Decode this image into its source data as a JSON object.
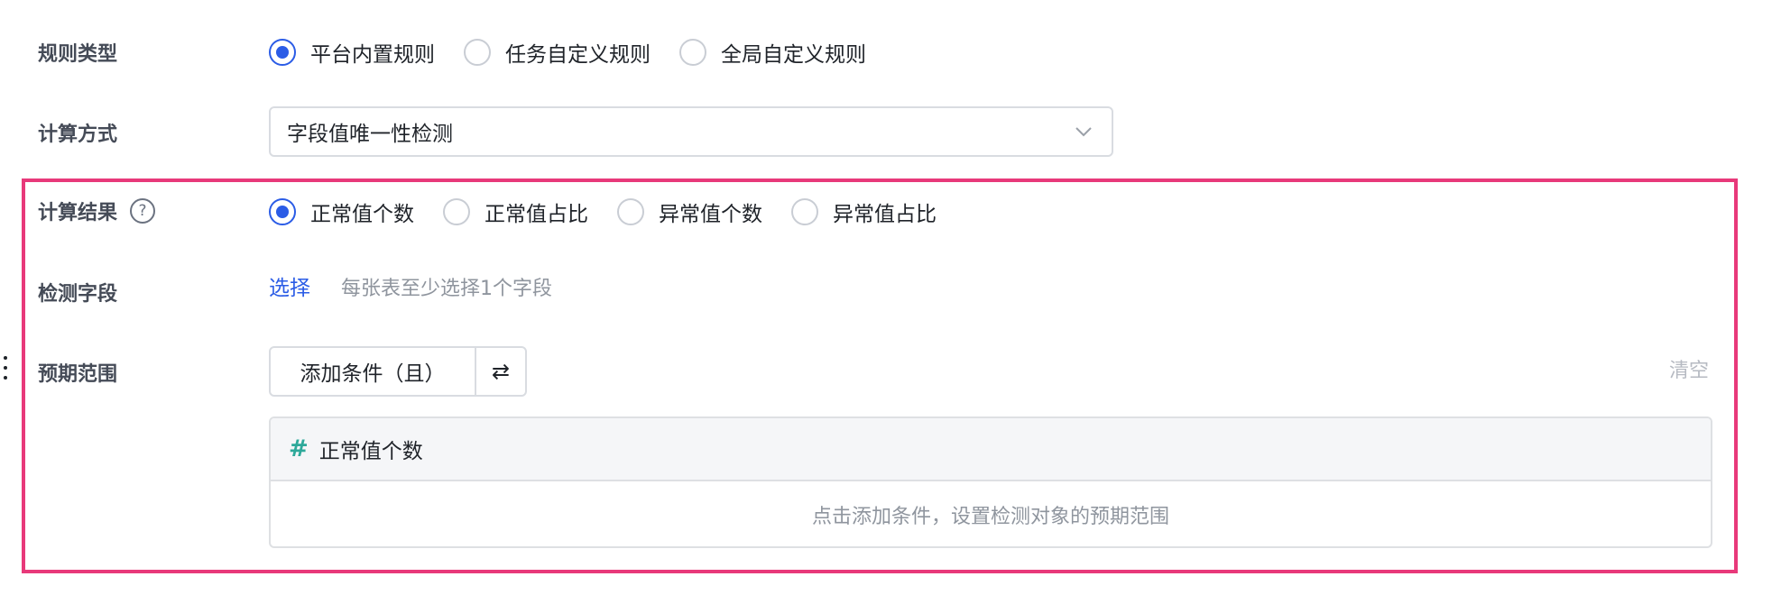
{
  "colors": {
    "accent": "#2b5ce6",
    "highlight_border": "#e8397a",
    "hash_icon": "#2ea99a"
  },
  "rule_type": {
    "label": "规则类型",
    "options": [
      "平台内置规则",
      "任务自定义规则",
      "全局自定义规则"
    ],
    "selected_index": 0
  },
  "calc_method": {
    "label": "计算方式",
    "value": "字段值唯一性检测",
    "icon": "chevron-down-icon"
  },
  "calc_result": {
    "label": "计算结果",
    "help_icon": "question-circle-icon",
    "help_glyph": "?",
    "options": [
      "正常值个数",
      "正常值占比",
      "异常值个数",
      "异常值占比"
    ],
    "selected_index": 0
  },
  "detect_field": {
    "label": "检测字段",
    "link": "选择",
    "hint": "每张表至少选择1个字段"
  },
  "expected_range": {
    "label": "预期范围",
    "add_button": "添加条件（且）",
    "switch_icon": "swap-arrows-icon",
    "switch_glyph": "⇄",
    "clear": "清空",
    "card": {
      "icon": "hash-icon",
      "icon_glyph": "#",
      "title": "正常值个数",
      "empty_hint": "点击添加条件，设置检测对象的预期范围"
    }
  }
}
